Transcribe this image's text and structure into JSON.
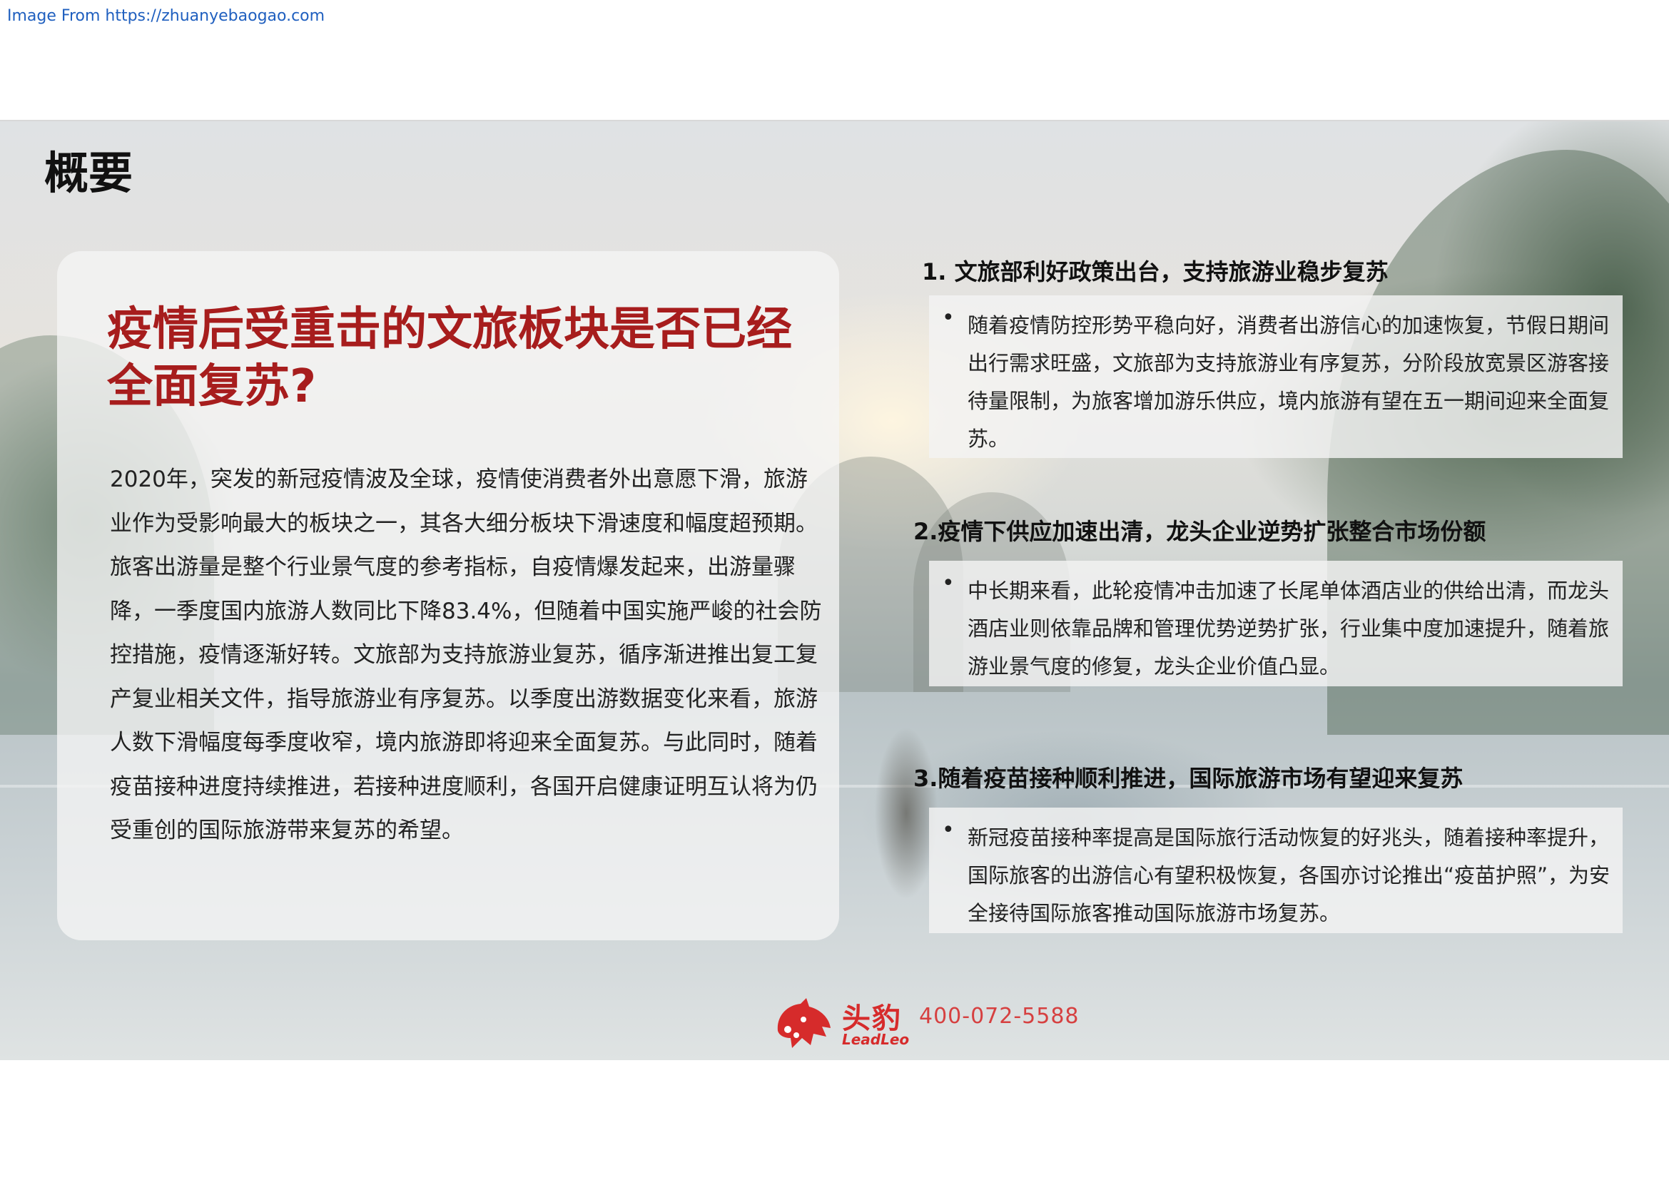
{
  "source_watermark": "Image From https://zhuanyebaogao.com",
  "page_title": "概要",
  "headline": "疫情后受重击的文旅板块是否已经全面复苏?",
  "body_paragraph": "2020年，突发的新冠疫情波及全球，疫情使消费者外出意愿下滑，旅游业作为受影响最大的板块之一，其各大细分板块下滑速度和幅度超预期。旅客出游量是整个行业景气度的参考指标，自疫情爆发起来，出游量骤降，一季度国内旅游人数同比下降83.4%，但随着中国实施严峻的社会防控措施，疫情逐渐好转。文旅部为支持旅游业复苏，循序渐进推出复工复产复业相关文件，指导旅游业有序复苏。以季度出游数据变化来看，旅游人数下滑幅度每季度收窄，境内旅游即将迎来全面复苏。与此同时，随着疫苗接种进度持续推进，若接种进度顺利，各国开启健康证明互认将为仍受重创的国际旅游带来复苏的希望。",
  "sections": [
    {
      "heading": "1. 文旅部利好政策出台，支持旅游业稳步复苏",
      "bullet": "随着疫情防控形势平稳向好，消费者出游信心的加速恢复，节假日期间出行需求旺盛，文旅部为支持旅游业有序复苏，分阶段放宽景区游客接待量限制，为旅客增加游乐供应，境内旅游有望在五一期间迎来全面复苏。"
    },
    {
      "heading": "2.疫情下供应加速出清，龙头企业逆势扩张整合市场份额",
      "bullet": "中长期来看，此轮疫情冲击加速了长尾单体酒店业的供给出清，而龙头酒店业则依靠品牌和管理优势逆势扩张，行业集中度加速提升，随着旅游业景气度的修复，龙头企业价值凸显。"
    },
    {
      "heading": "3.随着疫苗接种顺利推进，国际旅游市场有望迎来复苏",
      "bullet": "新冠疫苗接种率提高是国际旅行活动恢复的好兆头，随着接种率提升，国际旅客的出游信心有望积极恢复，各国亦讨论推出“疫苗护照”，为安全接待国际旅客推动国际旅游市场复苏。"
    }
  ],
  "footer": {
    "logo_cn": "头豹",
    "logo_en": "LeadLeo",
    "phone": "400-072-5588",
    "logo_icon": "leopard-head-icon",
    "brand_color": "#d62b2b"
  },
  "colors": {
    "headline": "#a71d1d",
    "link": "#1f5fbf"
  }
}
